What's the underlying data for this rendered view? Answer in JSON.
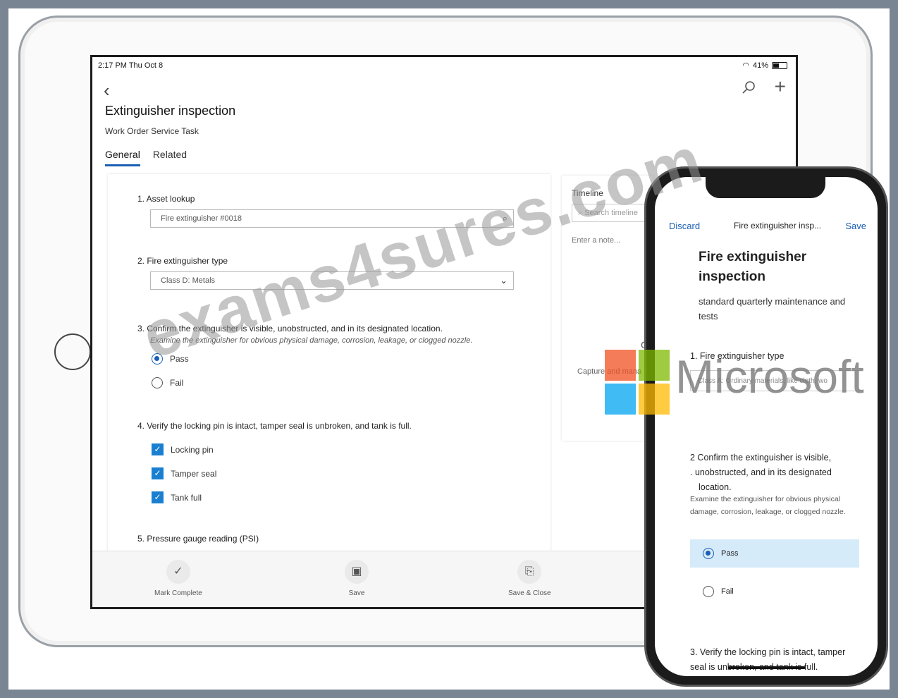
{
  "status": {
    "time": "2:17 PM  Thu Oct 8",
    "battery": "41%"
  },
  "header": {
    "title": "Extinguisher inspection",
    "subtitle": "Work Order Service Task",
    "tabs": [
      "General",
      "Related"
    ]
  },
  "form": {
    "q1": {
      "label": "1.  Asset lookup",
      "value": "Fire extinguisher #0018"
    },
    "q2": {
      "label": "2.  Fire extinguisher type",
      "value": "Class D: Metals"
    },
    "q3": {
      "label": "3.  Confirm the extinguisher is visible, unobstructed, and in its designated location.",
      "hint": "Examine the extinguisher for obvious physical damage, corrosion, leakage, or clogged nozzle.",
      "options": [
        "Pass",
        "Fail"
      ]
    },
    "q4": {
      "label": "4.  Verify the locking pin is intact, tamper seal is unbroken, and tank is full.",
      "checks": [
        "Locking pin",
        "Tamper seal",
        "Tank full"
      ]
    },
    "q5": {
      "label": "5.  Pressure gauge reading (PSI)"
    }
  },
  "timeline": {
    "label": "Timeline",
    "search_placeholder": "Search timeline",
    "note_placeholder": "Enter a note...",
    "capture": "Capture and mana",
    "heading_fragment": "G"
  },
  "bottom_bar": {
    "mark_complete": "Mark Complete",
    "save": "Save",
    "save_close": "Save & Close"
  },
  "watermark": {
    "text": "exams4sures.com",
    "brand": "Microsoft"
  },
  "phone": {
    "discard": "Discard",
    "header_title": "Fire extinguisher insp...",
    "save": "Save",
    "title": "Fire extinguisher inspection",
    "subtitle": "standard quarterly maintenance and tests",
    "q1": "1. Fire extinguisher type",
    "q1_value": "Class A: Ordinary materials, like cloth, wo",
    "q2_line1": "2 Confirm the extinguisher is visible,",
    "q2_line2": ". unobstructed, and in its designated",
    "q2_line3": "location.",
    "q2_hint": "Examine the extinguisher for obvious physical damage, corrosion, leakage, or clogged nozzle.",
    "pass": "Pass",
    "fail": "Fail",
    "q3": "3. Verify the locking pin is intact, tamper seal is unbroken, and tank is full."
  }
}
